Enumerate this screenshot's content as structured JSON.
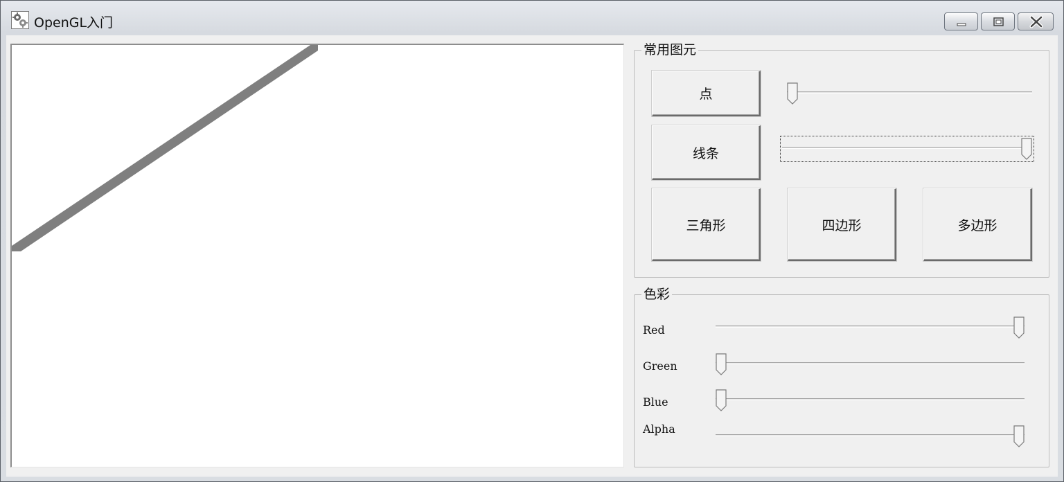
{
  "window": {
    "title": "OpenGL入门",
    "controls": {
      "minimize": "minimize",
      "maximize": "maximize",
      "close": "close"
    }
  },
  "primitives": {
    "title": "常用图元",
    "point_label": "点",
    "line_label": "线条",
    "triangle_label": "三角形",
    "quad_label": "四边形",
    "polygon_label": "多边形",
    "point_size_level": 0.0,
    "line_width_level": 1.0
  },
  "colors": {
    "title": "色彩",
    "red_label": "Red",
    "green_label": "Green",
    "blue_label": "Blue",
    "alpha_label": "Alpha",
    "red_level": 1.0,
    "green_level": 0.0,
    "blue_level": 0.0,
    "alpha_level": 1.0
  },
  "canvas": {
    "background": "#ffffff",
    "line_color": "#7f7f7f"
  },
  "icons": [
    "app-gears-icon",
    "minimize-icon",
    "maximize-icon",
    "close-icon",
    "slider-thumb-icon"
  ]
}
